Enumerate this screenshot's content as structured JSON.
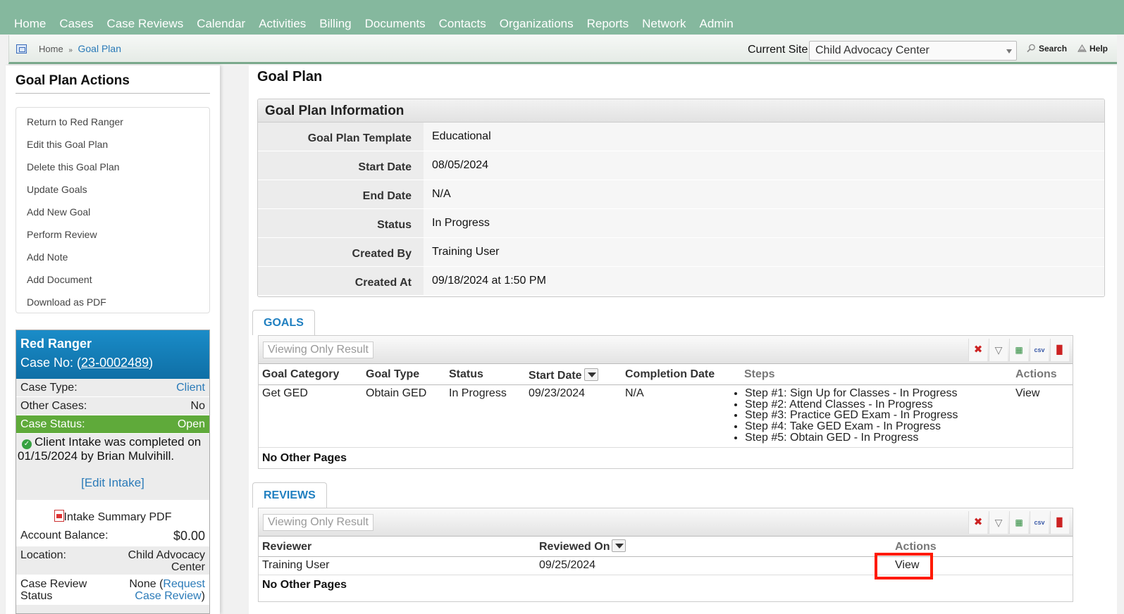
{
  "topnav": {
    "items": [
      "Home",
      "Cases",
      "Case Reviews",
      "Calendar",
      "Activities",
      "Billing",
      "Documents",
      "Contacts",
      "Organizations",
      "Reports",
      "Network",
      "Admin"
    ]
  },
  "breadcrumb": {
    "home": "Home",
    "separator": "»",
    "current": "Goal Plan"
  },
  "site": {
    "label": "Current Site",
    "selected": "Child Advocacy Center"
  },
  "tools": {
    "search": "Search",
    "help": "Help"
  },
  "sidebar": {
    "title": "Goal Plan Actions",
    "actions": [
      "Return to Red Ranger",
      "Edit this Goal Plan",
      "Delete this Goal Plan",
      "Update Goals",
      "Add New Goal",
      "Perform Review",
      "Add Note",
      "Add Document",
      "Download as PDF"
    ],
    "case": {
      "client_name": "Red Ranger",
      "case_no_label": "Case No:",
      "case_no": "23-0002489",
      "case_type_label": "Case Type:",
      "case_type": "Client",
      "other_cases_label": "Other Cases:",
      "other_cases": "No",
      "status_label": "Case Status:",
      "status": "Open",
      "intake_note": "Client Intake was completed on 01/15/2024 by Brian Mulvihill.",
      "edit_intake": "[Edit Intake]",
      "intake_pdf": "Intake Summary PDF",
      "balance_label": "Account Balance:",
      "balance": "$0.00",
      "location_label": "Location:",
      "location": "Child Advocacy Center",
      "review_label": "Case Review Status",
      "review_status": "None",
      "request_review": "Request Case Review"
    }
  },
  "main": {
    "title": "Goal Plan",
    "info": {
      "heading": "Goal Plan Information",
      "rows": [
        {
          "label": "Goal Plan Template",
          "value": "Educational"
        },
        {
          "label": "Start Date",
          "value": "08/05/2024"
        },
        {
          "label": "End Date",
          "value": "N/A"
        },
        {
          "label": "Status",
          "value": "In Progress"
        },
        {
          "label": "Created By",
          "value": "Training User"
        },
        {
          "label": "Created At",
          "value": "09/18/2024 at 1:50 PM"
        }
      ]
    },
    "goals": {
      "tab": "GOALS",
      "viewing": "Viewing Only Result",
      "columns": [
        "Goal Category",
        "Goal Type",
        "Status",
        "Start Date",
        "Completion Date",
        "Steps",
        "Actions"
      ],
      "row": {
        "category": "Get GED",
        "type": "Obtain GED",
        "status": "In Progress",
        "start": "09/23/2024",
        "completion": "N/A",
        "steps": [
          "Step #1: Sign Up for Classes - In Progress",
          "Step #2: Attend Classes - In Progress",
          "Step #3: Practice GED Exam - In Progress",
          "Step #4: Take GED Exam - In Progress",
          "Step #5: Obtain GED - In Progress"
        ],
        "action": "View"
      },
      "footer": "No Other Pages"
    },
    "reviews": {
      "tab": "REVIEWS",
      "viewing": "Viewing Only Result",
      "columns": [
        "Reviewer",
        "Reviewed On",
        "Actions"
      ],
      "row": {
        "reviewer": "Training User",
        "reviewed_on": "09/25/2024",
        "action": "View"
      },
      "footer": "No Other Pages"
    },
    "toolbar_icons": {
      "csv": "csv"
    }
  },
  "colors": {
    "nav": "#85b89e",
    "accent": "#2a7ab8",
    "status_open": "#5faa3a",
    "highlight": "#ff1a00"
  }
}
